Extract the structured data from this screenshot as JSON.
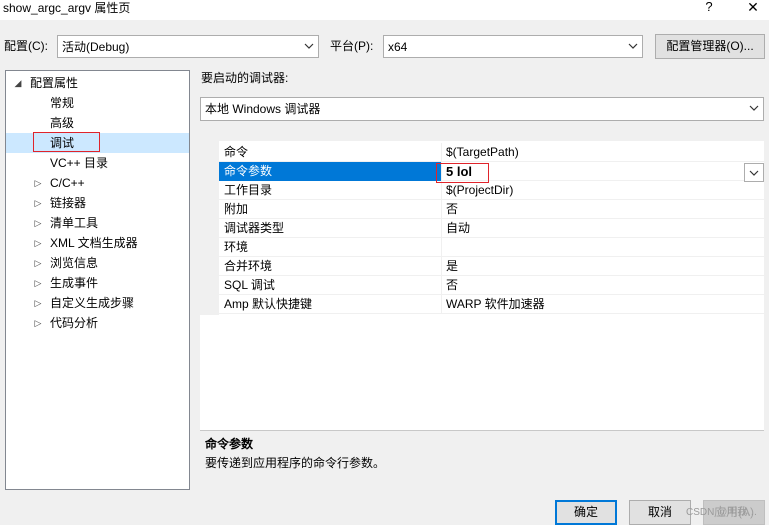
{
  "window": {
    "title": "show_argc_argv 属性页",
    "help": "?",
    "close": "✕"
  },
  "config_bar": {
    "config_label": "配置(C):",
    "config_value": "活动(Debug)",
    "platform_label": "平台(P):",
    "platform_value": "x64",
    "manager_button": "配置管理器(O)..."
  },
  "tree": {
    "root": "配置属性",
    "items": [
      "常规",
      "高级",
      "调试",
      "VC++ 目录",
      "C/C++",
      "链接器",
      "清单工具",
      "XML 文档生成器",
      "浏览信息",
      "生成事件",
      "自定义生成步骤",
      "代码分析"
    ],
    "selected": "调试"
  },
  "debugger": {
    "label": "要启动的调试器:",
    "value": "本地 Windows 调试器"
  },
  "properties": [
    {
      "name": "命令",
      "value": "$(TargetPath)"
    },
    {
      "name": "命令参数",
      "value": "5 lol"
    },
    {
      "name": "工作目录",
      "value": "$(ProjectDir)"
    },
    {
      "name": "附加",
      "value": "否"
    },
    {
      "name": "调试器类型",
      "value": "自动"
    },
    {
      "name": "环境",
      "value": ""
    },
    {
      "name": "合并环境",
      "value": "是"
    },
    {
      "name": "SQL 调试",
      "value": "否"
    },
    {
      "name": "Amp 默认快捷键",
      "value": "WARP 软件加速器"
    }
  ],
  "description": {
    "title": "命令参数",
    "text": "要传递到应用程序的命令行参数。"
  },
  "buttons": {
    "ok": "确定",
    "cancel": "取消",
    "apply": "应用(A)"
  },
  "watermark": "CSDN @叫我…",
  "colors": {
    "selection": "#0078d7",
    "highlight_box": "#e0242b",
    "tree_selected": "#cce8ff"
  }
}
